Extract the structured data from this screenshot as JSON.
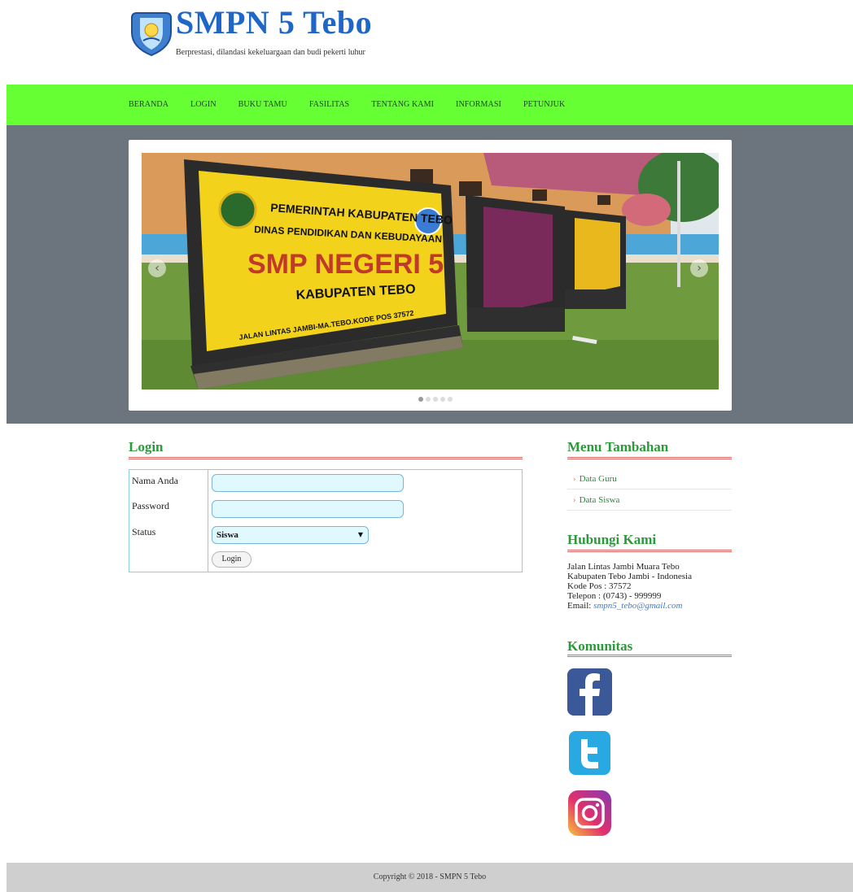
{
  "header": {
    "title": "SMPN 5 Tebo",
    "tagline": "Berprestasi, dilandasi kekeluargaan dan budi pekerti luhur"
  },
  "nav": {
    "items": [
      "BERANDA",
      "LOGIN",
      "BUKU TAMU",
      "FASILITAS",
      "TENTANG KAMI",
      "INFORMASI",
      "PETUNJUK"
    ]
  },
  "slider": {
    "sign_line1": "PEMERINTAH KABUPATEN TEBO",
    "sign_line2": "DINAS PENDIDIKAN DAN KEBUDAYAAN",
    "sign_line3": "SMP NEGERI 5",
    "sign_line4": "KABUPATEN TEBO",
    "sign_line5": "JALAN LINTAS JAMBI-MA.TEBO.KODE POS 37572",
    "dots_total": 5,
    "active_dot": 1
  },
  "login": {
    "title": "Login",
    "name_label": "Nama Anda",
    "password_label": "Password",
    "status_label": "Status",
    "status_value": "Siswa",
    "button_label": "Login"
  },
  "sidebar": {
    "menu_title": "Menu Tambahan",
    "menu_items": [
      "Data Guru",
      "Data Siswa"
    ],
    "contact_title": "Hubungi Kami",
    "contact": {
      "address": "Jalan Lintas Jambi Muara Tebo",
      "city": "Kabupaten Tebo Jambi - Indonesia",
      "postal": "Kode Pos : 37572",
      "phone": "Telepon : (0743) - 999999",
      "email_label": "Email:",
      "email": "smpn5_tebo@gmail.com"
    },
    "community_title": "Komunitas",
    "social": [
      "facebook-icon",
      "twitter-icon",
      "instagram-icon"
    ]
  },
  "footer": {
    "copyright": "Copyright © 2018 - SMPN 5 Tebo"
  },
  "colors": {
    "nav": "#66ff33",
    "hero": "#6c757d",
    "title": "#1f66c9",
    "section_title": "#2a9a3a",
    "footer": "#cfcfcf"
  }
}
